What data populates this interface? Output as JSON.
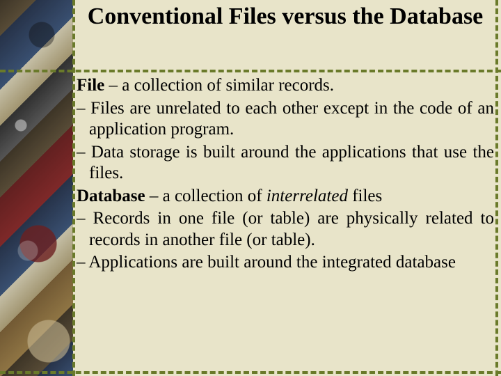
{
  "title": "Conventional Files versus the Database",
  "file": {
    "term": "File",
    "def": " – a collection of similar records.",
    "bullets": [
      "– Files are unrelated to each other except in the code of an application program.",
      "– Data storage is built around the applications that use the files."
    ]
  },
  "database": {
    "term": "Database",
    "def_prefix": " – a collection of ",
    "def_em": "interrelated",
    "def_suffix": " files",
    "bullets": [
      "– Records in one file (or table) are physically related to records in another file (or table).",
      "– Applications are built around the integrated database"
    ]
  }
}
